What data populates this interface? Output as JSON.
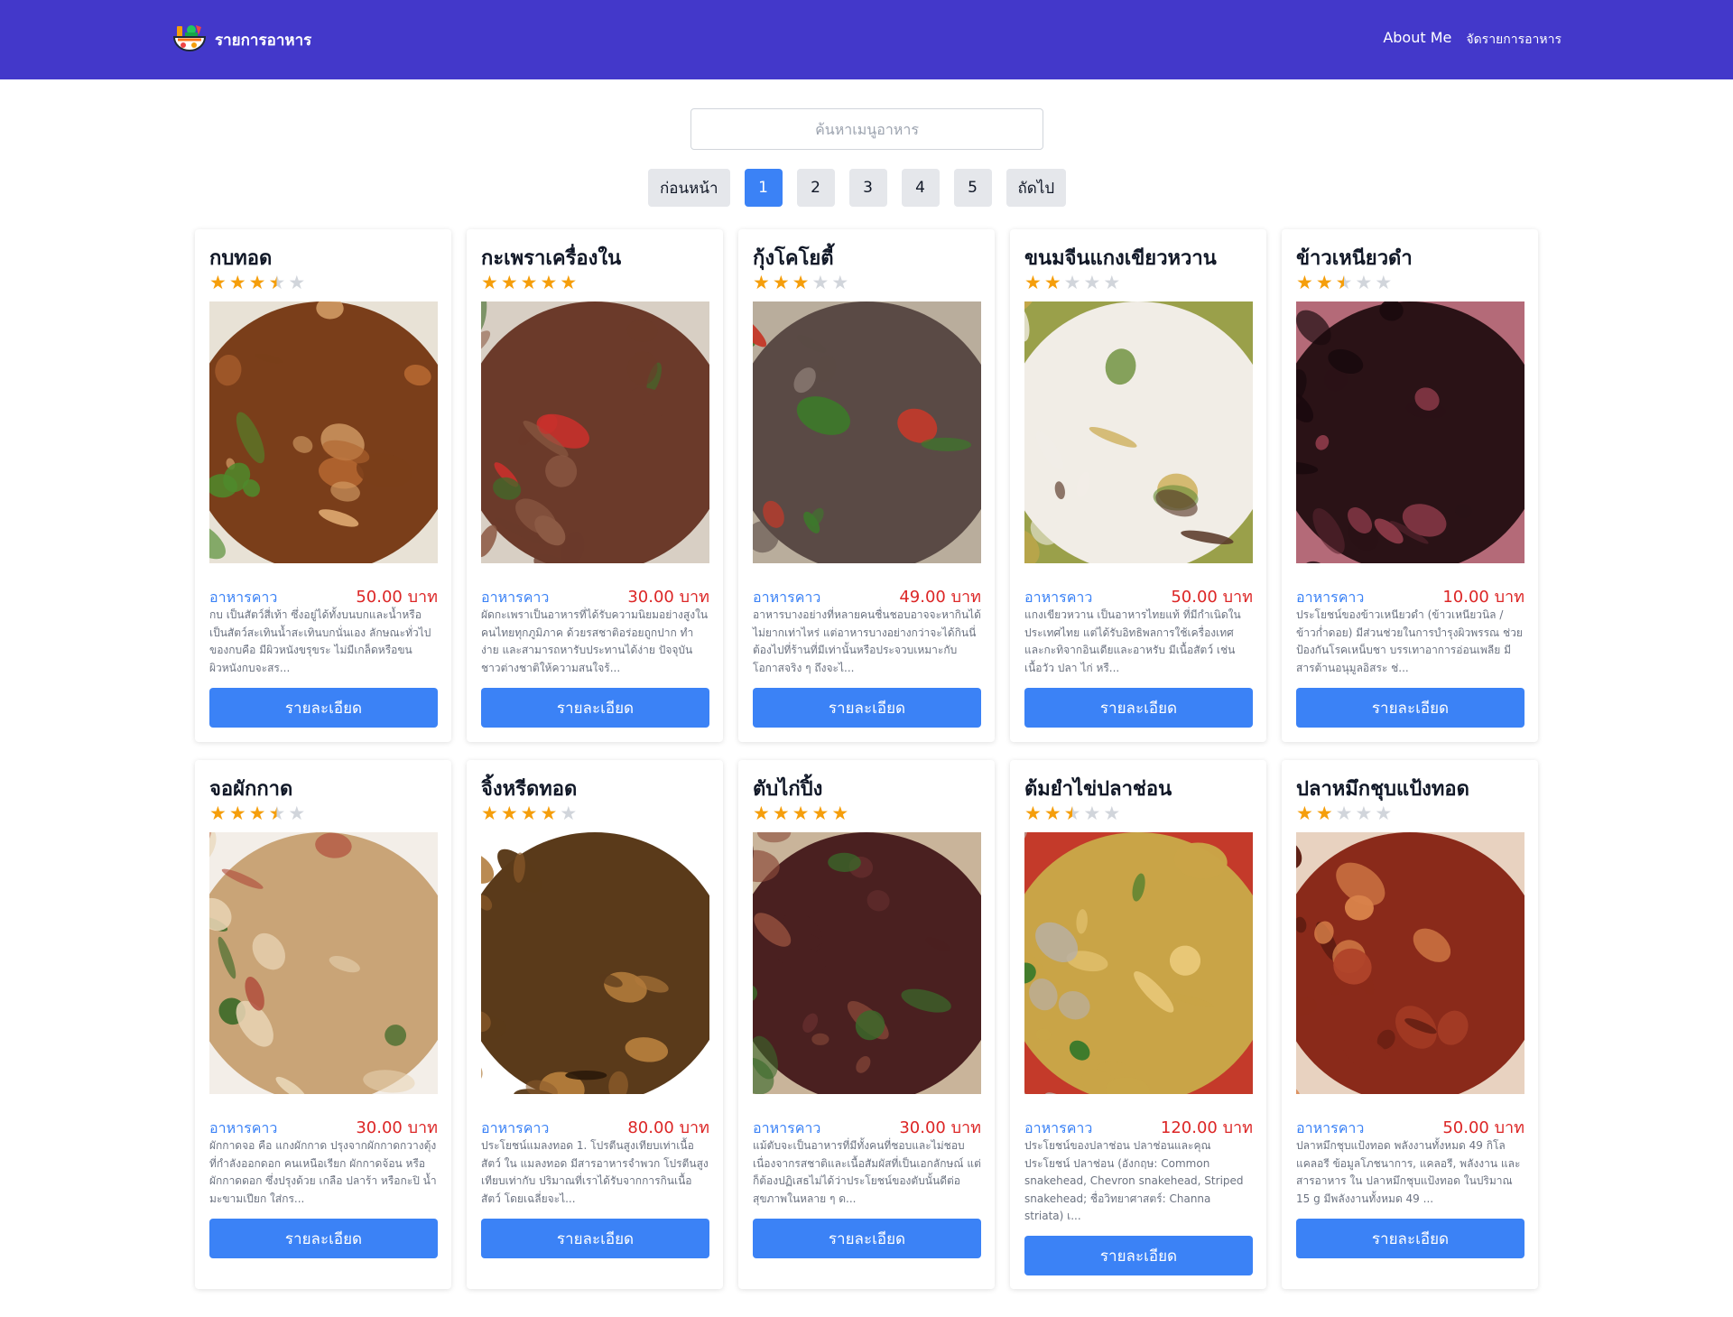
{
  "brand": {
    "title": "รายการอาหาร"
  },
  "nav": {
    "about": "About Me",
    "manage": "จัดรายการอาหาร"
  },
  "search": {
    "placeholder": "ค้นหาเมนูอาหาร"
  },
  "pagination": {
    "prev": "ก่อนหน้า",
    "next": "ถัดไป",
    "pages": [
      "1",
      "2",
      "3",
      "4",
      "5"
    ],
    "current": "1"
  },
  "detail_label": "รายละเอียด",
  "menus": [
    {
      "name": "กบทอด",
      "rating": 3.5,
      "category": "อาหารคาว",
      "price": "50.00 บาท",
      "desc": "กบ เป็นสัตว์สี่เท้า ซึ่งอยู่ได้ทั้งบนบกและน้ำหรือเป็นสัตว์สะเทินน้ำสะเทินบกนั่นเอง ลักษณะทั่วไปของกบคือ มีผิวหนังขรุขระ ไม่มีเกล็ดหรือขนผิวหนังกบจะสร...",
      "palette": [
        "#7a3e1a",
        "#b0642f",
        "#d9a36b",
        "#4f8a2c",
        "#e8e2d6"
      ]
    },
    {
      "name": "กะเพราเครื่องใน",
      "rating": 5,
      "category": "อาหารคาว",
      "price": "30.00 บาท",
      "desc": "ผัดกะเพราเป็นอาหารที่ได้รับความนิยมอย่างสูงในคนไทยทุกภูมิภาค ด้วยรสชาติอร่อยถูกปาก ทำง่าย และสามารถหารับประทานได้ง่าย ปัจจุบันชาวต่างชาติให้ความสนใจร้...",
      "palette": [
        "#6b3a2a",
        "#8c5a44",
        "#3f6b2a",
        "#c9302c",
        "#d8cfc4"
      ]
    },
    {
      "name": "กุ้งโคโยตี้",
      "rating": 3,
      "category": "อาหารคาว",
      "price": "49.00 บาท",
      "desc": "อาหารบางอย่างที่หลายคนชื่นชอบอาจจะหากินได้ไม่ยากเท่าไหร่ แต่อาหารบางอย่างกว่าจะได้กินนี่ต้องไปที่ร้านที่มีเท่านั้นหรือประจวบเหมาะกับโอกาสจริง ๆ ถึงจะไ...",
      "palette": [
        "#5a4a45",
        "#8a7a72",
        "#3c7a2a",
        "#c43a2a",
        "#b9ad9c"
      ]
    },
    {
      "name": "ขนมจีนแกงเขียวหวาน",
      "rating": 2,
      "category": "อาหารคาว",
      "price": "50.00 บาท",
      "desc": "แกงเขียวหวาน เป็นอาหารไทยแท้ ที่มีกำเนิดในประเทศไทย แต่ได้รับอิทธิพลการใช้เครื่องเทศและกะทิจากอินเดียและอาหรับ มีเนื้อสัตว์ เช่น เนื้อวัว ปลา ไก่ หรื...",
      "palette": [
        "#f1ede6",
        "#c9a84a",
        "#6b8f3a",
        "#5a3a2a",
        "#9aa04a"
      ]
    },
    {
      "name": "ข้าวเหนียวดำ",
      "rating": 2.5,
      "category": "อาหารคาว",
      "price": "10.00 บาท",
      "desc": "ประโยชน์ของข้าวเหนียวดำ (ข้าวเหนียวนิล / ข้าวก่ำดอย) มีส่วนช่วยในการบำรุงผิวพรรณ ช่วยป้องกันโรคเหน็บชา บรรเทาอาการอ่อนเพลีย มีสารต้านอนุมูลอิสระ ช่...",
      "palette": [
        "#2a1216",
        "#5a2630",
        "#8a3a48",
        "#1a0a0e",
        "#b46a78"
      ]
    },
    {
      "name": "จอผักกาด",
      "rating": 3.5,
      "category": "อาหารคาว",
      "price": "30.00 บาท",
      "desc": "ผักกาดจอ คือ แกงผักกาด ปรุงจากผักกาดกวางตุ้งที่กำลังออกดอก คนเหนือเรียก ผักกาดจ้อน หรือผักกาดดอก ซึ่งปรุงด้วย เกลือ ปลาร้า หรือกะปิ น้ำมะขามเปียก ใส่กร...",
      "palette": [
        "#c9a477",
        "#e7d3b3",
        "#3f6b2a",
        "#b04a3a",
        "#f3eee8"
      ]
    },
    {
      "name": "จิ้งหรีดทอด",
      "rating": 4,
      "category": "อาหารคาว",
      "price": "80.00 บาท",
      "desc": "ประโยชน์แมลงทอด 1. โปรตีนสูงเทียบเท่าเนื้อสัตว์ ใน แมลงทอด มีสารอาหารจำพวก โปรตีนสูง เทียบเท่ากับ ปริมาณที่เราได้รับจากการกินเนื้อสัตว์ โดยเฉลี่ยจะไ...",
      "palette": [
        "#5a3a1a",
        "#8a5a2a",
        "#2a1a0a",
        "#b07a3a",
        "#ffffff"
      ]
    },
    {
      "name": "ตับไก่ปิ้ง",
      "rating": 5,
      "category": "อาหารคาว",
      "price": "30.00 บาท",
      "desc": "แม้ตับจะเป็นอาหารที่มีทั้งคนที่ชอบและไม่ชอบ เนื่องจากรสชาติและเนื้อสัมผัสที่เป็นเอกลักษณ์ แต่ก็ต้องปฏิเสธไม่ได้ว่าประโยชน์ของตับนั้นดีต่อสุขภาพในหลาย ๆ ด...",
      "palette": [
        "#4a2020",
        "#6a3030",
        "#8a4a3a",
        "#3a6a2a",
        "#c9b49a"
      ]
    },
    {
      "name": "ต้มยำไข่ปลาช่อน",
      "rating": 2.5,
      "category": "อาหารคาว",
      "price": "120.00 บาท",
      "desc": "ประโยชน์ของปลาช่อน ปลาช่อนและคุณประโยชน์ ปลาช่อน (อังกฤษ: Common snakehead, Chevron snakehead, Striped snakehead; ชื่อวิทยาศาสตร์: Channa striata) เ...",
      "palette": [
        "#c9a447",
        "#e8c878",
        "#3a7a2a",
        "#b8b0a8",
        "#c43a2a"
      ]
    },
    {
      "name": "ปลาหมึกชุบแป้งทอด",
      "rating": 2,
      "category": "อาหารคาว",
      "price": "50.00 บาท",
      "desc": "ปลาหมึกชุบแป้งทอด พลังงานทั้งหมด 49 กิโลแคลอรี ข้อมูลโภชนาการ, แคลอรี, พลังงาน และสารอาหาร ใน ปลาหมึกชุบแป้งทอด ในปริมาณ 15 g มีพลังงานทั้งหมด 49 ...",
      "palette": [
        "#8a2a1a",
        "#b0442a",
        "#d9824a",
        "#5a1a10",
        "#e8d2c0"
      ]
    }
  ]
}
